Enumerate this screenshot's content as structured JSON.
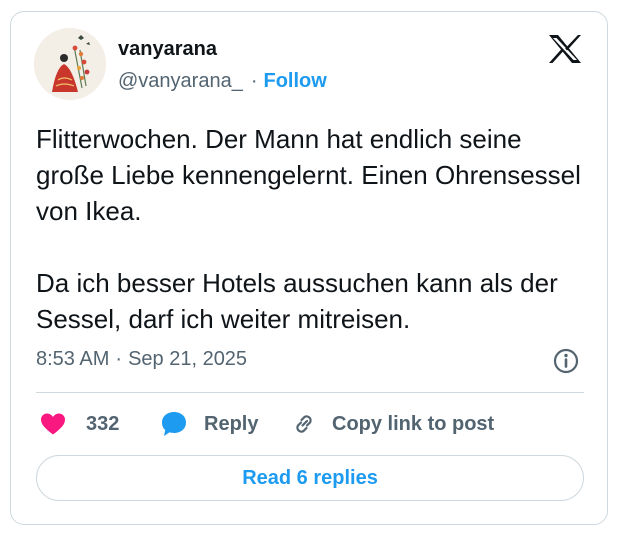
{
  "user": {
    "name": "vanyarana",
    "handle": "@vanyarana_",
    "separator": "·",
    "follow_label": "Follow"
  },
  "tweet": {
    "paragraphs": [
      "Flitterwochen. Der Mann hat endlich seine große Liebe kennengelernt. Einen Ohrensessel von Ikea.",
      "Da ich besser Hotels aussuchen kann als der Sessel, darf ich weiter mitreisen."
    ]
  },
  "meta": {
    "time": "8:53 AM",
    "separator": "·",
    "date": "Sep 21, 2025"
  },
  "actions": {
    "like_count": "332",
    "reply_label": "Reply",
    "copy_label": "Copy link to post"
  },
  "read_replies_label": "Read 6 replies",
  "icons": {
    "logo": "x-logo-icon",
    "info": "info-icon",
    "like": "heart-icon",
    "reply": "speech-bubble-icon",
    "copy": "link-icon"
  },
  "colors": {
    "accent": "#1d9bf0",
    "like": "#f91880",
    "secondary_text": "#536471",
    "border": "#cfd9de"
  }
}
